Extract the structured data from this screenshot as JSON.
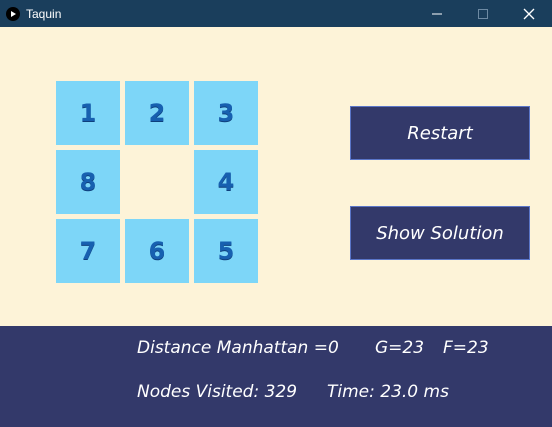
{
  "window": {
    "title": "Taquin",
    "controls": {
      "minimize": "—",
      "maximize": "☐",
      "close": "✕"
    }
  },
  "board": {
    "tiles": [
      "1",
      "2",
      "3",
      "8",
      "",
      "4",
      "7",
      "6",
      "5"
    ]
  },
  "buttons": {
    "restart": "Restart",
    "show_solution": "Show Solution"
  },
  "status": {
    "manhattan": "Distance Manhattan =0",
    "g": "G=23",
    "f": "F=23",
    "nodes": "Nodes Visited: 329",
    "time": "Time: 23.0 ms"
  },
  "colors": {
    "background": "#fdf3d8",
    "tile": "#7dd6f8",
    "tile_text": "#1760b0",
    "panel": "#33396a",
    "titlebar": "#1a3e5c"
  }
}
